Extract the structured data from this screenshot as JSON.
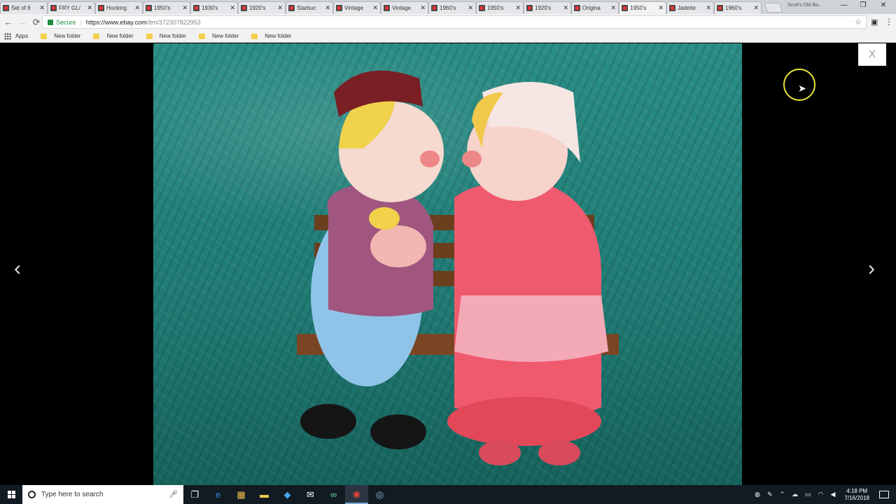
{
  "tabs": [
    {
      "title": "Set of 6"
    },
    {
      "title": "FRY GL/"
    },
    {
      "title": "Hocking"
    },
    {
      "title": "1950's"
    },
    {
      "title": "1930's"
    },
    {
      "title": "1920's"
    },
    {
      "title": "Starbuc"
    },
    {
      "title": "Vintage"
    },
    {
      "title": "Vintage"
    },
    {
      "title": "1960's"
    },
    {
      "title": "1950's"
    },
    {
      "title": "1920's"
    },
    {
      "title": "Origina"
    },
    {
      "title": "1950's"
    },
    {
      "title": "Jadeite"
    },
    {
      "title": "1960's"
    }
  ],
  "active_tab_index": 13,
  "window": {
    "user_label": "Scott's Old Ba...",
    "minimize": "—",
    "restore": "❐",
    "close": "✕"
  },
  "address": {
    "secure_label": "Secure",
    "url_host": "https://www.ebay.com",
    "url_path": "/itm/372307822953",
    "back": "←",
    "forward": "→",
    "reload": "⟳",
    "star": "☆"
  },
  "bookmarks": {
    "apps_label": "Apps",
    "items": [
      "New folder",
      "New folder",
      "New folder",
      "New folder",
      "New folder"
    ]
  },
  "viewer": {
    "close_label": "X",
    "prev_arrow": "‹",
    "next_arrow": "›"
  },
  "taskbar": {
    "search_placeholder": "Type here to search",
    "clock_time": "4:18 PM",
    "clock_date": "7/16/2018"
  },
  "colors": {
    "ebay_red": "#e53238",
    "secure_green": "#1e8e3e",
    "cursor_ring": "#e9e23a"
  }
}
